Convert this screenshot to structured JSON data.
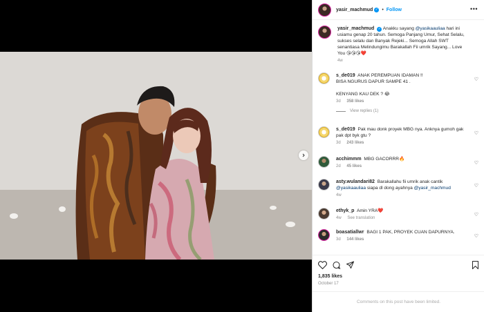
{
  "post": {
    "username": "yasir_machmud",
    "follow_label": "Follow",
    "caption_parts": {
      "a": "Anakku sayang ",
      "mention": "@yasikaauliaa",
      "b": " hari ini usiamu genap 20 tahun. Semoga Panjang Umur, Sehat Selalu, sukses selalu dan Banyak Rejeki... Semoga Allah SWT senantiasa Melindungimu Barakallah Fii umrik Sayang... Love You 😘😘😘❤️"
    },
    "caption_time": "4w"
  },
  "comments": [
    {
      "user": "s_de019",
      "text": "ANAK PEREMPUAN IDAMAN !!\nBISA NGURUS DAPUR SAMPE 41 .\n\nKENYANG KAU DEK ? 😂",
      "time": "3d",
      "likes": "358 likes",
      "replies": "View replies (1)"
    },
    {
      "user": "s_de019",
      "text": "Pak mau donk proyek MBG nya. Anknya gumoh gak pak dpt byk gtu ?",
      "time": "3d",
      "likes": "243 likes"
    },
    {
      "user": "acchimmm",
      "text": "MBG GACORRR🔥",
      "time": "2d",
      "likes": "45 likes"
    },
    {
      "user": "asty.wulandari82",
      "text_a": "Barakallahu fii umrik anak cantik ",
      "mention_a": "@yasikaauliaa",
      "text_b": " siapa dl dong ayahnya ",
      "mention_b": "@yasir_machmud",
      "time": "4w"
    },
    {
      "user": "ethyk_p",
      "text": "Amin YRA❤️",
      "time": "4w",
      "extra": "See translation"
    },
    {
      "user": "boasatiallwr",
      "text": "BAGI 1 PAK, PROYEK CUAN DAPURNYA.",
      "time": "3d",
      "likes": "144 likes"
    }
  ],
  "stats": {
    "likes": "1,835 likes",
    "date": "October 17",
    "comments_limited": "Comments on this post have been limited."
  },
  "icons": {
    "verified": "verified-badge-icon",
    "more": "more-options-icon",
    "heart": "heart-icon",
    "comment": "comment-icon",
    "share": "share-icon",
    "save": "bookmark-icon",
    "next": "chevron-right-icon"
  },
  "colors": {
    "accent": "#0095f6",
    "mention": "#00376b",
    "muted": "#8e8e8e"
  }
}
